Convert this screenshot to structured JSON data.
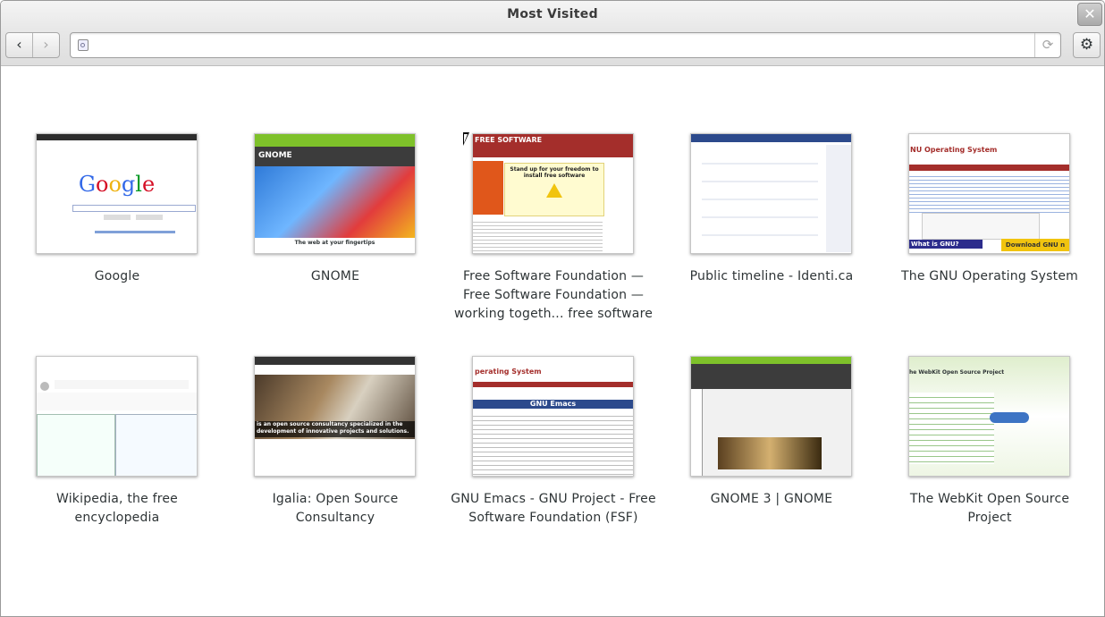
{
  "window": {
    "title": "Most Visited",
    "close_glyph": "✕"
  },
  "toolbar": {
    "back_glyph": "‹",
    "forward_glyph": "›",
    "url_value": "",
    "reload_glyph": "⟳",
    "menu_glyph": "⚙"
  },
  "tiles": [
    {
      "caption": "Google",
      "thumb_text": "Google"
    },
    {
      "caption": "GNOME",
      "thumb_text": "GNOME",
      "thumb_sub": "The web at your fingertips"
    },
    {
      "caption": "Free Software Foundation — Free Software Foundation — working togeth... free software",
      "thumb_text": "FREE SOFTWARE",
      "thumb_sub": "Stand up for your freedom to install free software"
    },
    {
      "caption": "Public timeline - Identi.ca"
    },
    {
      "caption": "The GNU Operating System",
      "thumb_text": "NU Operating System",
      "thumb_sub": "What is GNU?",
      "thumb_btn": "Download GNU n"
    },
    {
      "caption": "Wikipedia, the free encyclopedia"
    },
    {
      "caption": "Igalia: Open Source Consultancy",
      "thumb_text": "is an open source consultancy specialized in the development of innovative projects and solutions."
    },
    {
      "caption": "GNU Emacs - GNU Project - Free Software Foundation (FSF)",
      "thumb_text": "perating System",
      "thumb_sub": "GNU Emacs"
    },
    {
      "caption": "GNOME 3 | GNOME"
    },
    {
      "caption": "The WebKit Open Source Project",
      "thumb_text": "he WebKit Open Source Project"
    }
  ]
}
